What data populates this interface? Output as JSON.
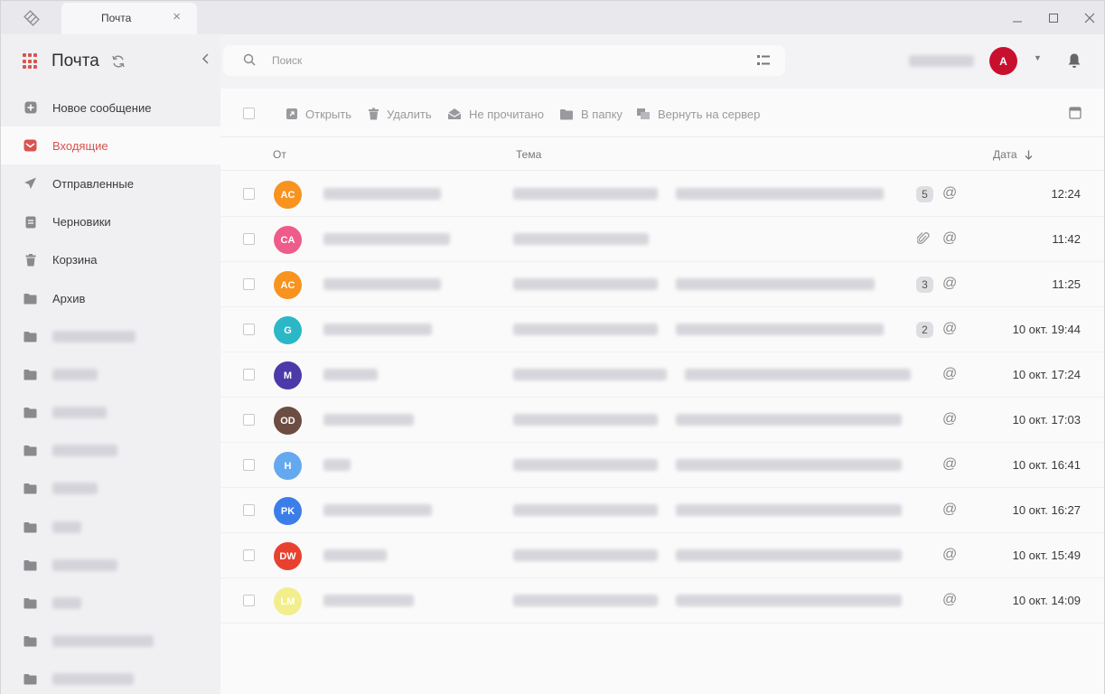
{
  "window": {
    "tab_title": "Почта",
    "tab_close": "×",
    "controls": {
      "minimize": "minimize-icon",
      "maximize": "maximize-icon",
      "close": "close-icon"
    }
  },
  "sidebar": {
    "title": "Почта",
    "items": [
      {
        "label": "Новое сообщение",
        "icon": "plus-square-icon",
        "active": false
      },
      {
        "label": "Входящие",
        "icon": "inbox-icon",
        "active": true
      },
      {
        "label": "Отправленные",
        "icon": "send-icon",
        "active": false
      },
      {
        "label": "Черновики",
        "icon": "draft-icon",
        "active": false
      },
      {
        "label": "Корзина",
        "icon": "trash-icon",
        "active": false
      },
      {
        "label": "Архив",
        "icon": "folder-icon",
        "active": false
      }
    ],
    "blurred_folders": [
      92,
      50,
      60,
      72,
      50,
      32,
      72,
      32,
      112,
      90
    ]
  },
  "search": {
    "placeholder": "Поиск"
  },
  "user": {
    "avatar_letter": "А",
    "avatar_color": "#c8102e"
  },
  "toolbar": {
    "open": "Открыть",
    "delete": "Удалить",
    "unread": "Не прочитано",
    "to_folder": "В папку",
    "return_to_server": "Вернуть на сервер"
  },
  "columns": {
    "from": "От",
    "subject": "Тема",
    "date": "Дата"
  },
  "messages": [
    {
      "initials": "AC",
      "color": "#f7931e",
      "from_w": 130,
      "subj_w": [
        160,
        230
      ],
      "count": "5",
      "attachment": false,
      "date": "12:24"
    },
    {
      "initials": "CA",
      "color": "#ef5b8a",
      "from_w": 140,
      "subj_w": [
        150,
        0
      ],
      "count": "",
      "attachment": true,
      "date": "11:42"
    },
    {
      "initials": "AC",
      "color": "#f7931e",
      "from_w": 130,
      "subj_w": [
        160,
        220
      ],
      "count": "3",
      "attachment": false,
      "date": "11:25"
    },
    {
      "initials": "G",
      "color": "#2bb7c6",
      "from_w": 120,
      "subj_w": [
        160,
        230
      ],
      "count": "2",
      "attachment": false,
      "date": "10 окт. 19:44"
    },
    {
      "initials": "M",
      "color": "#4b3aa8",
      "from_w": 60,
      "subj_w": [
        170,
        250
      ],
      "count": "",
      "attachment": false,
      "date": "10 окт. 17:24"
    },
    {
      "initials": "OD",
      "color": "#6d4c41",
      "from_w": 100,
      "subj_w": [
        160,
        250
      ],
      "count": "",
      "attachment": false,
      "date": "10 окт. 17:03"
    },
    {
      "initials": "H",
      "color": "#64a9f0",
      "from_w": 30,
      "subj_w": [
        160,
        250
      ],
      "count": "",
      "attachment": false,
      "date": "10 окт. 16:41"
    },
    {
      "initials": "PK",
      "color": "#3b7ee8",
      "from_w": 120,
      "subj_w": [
        160,
        250
      ],
      "count": "",
      "attachment": false,
      "date": "10 окт. 16:27"
    },
    {
      "initials": "DW",
      "color": "#e8412f",
      "from_w": 70,
      "subj_w": [
        160,
        250
      ],
      "count": "",
      "attachment": false,
      "date": "10 окт. 15:49"
    },
    {
      "initials": "LM",
      "color": "#f3ee8c",
      "from_w": 100,
      "subj_w": [
        160,
        250
      ],
      "count": "",
      "attachment": false,
      "date": "10 окт. 14:09"
    }
  ]
}
